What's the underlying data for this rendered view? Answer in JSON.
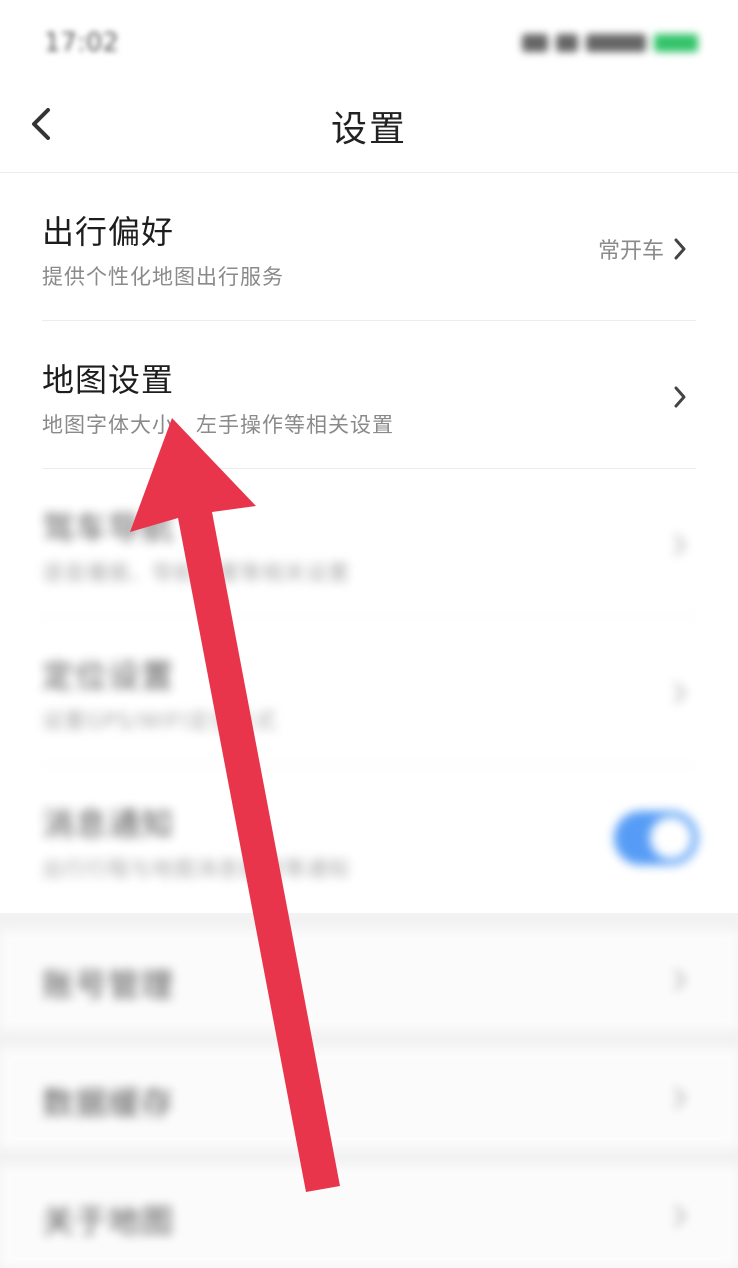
{
  "status_bar": {
    "time": "17:02"
  },
  "nav": {
    "title": "设置"
  },
  "settings": [
    {
      "title": "出行偏好",
      "subtitle": "提供个性化地图出行服务",
      "value": "常开车"
    },
    {
      "title": "地图设置",
      "subtitle": "地图字体大小、左手操作等相关设置"
    },
    {
      "title": "驾车导航",
      "subtitle": "语音播报、导航设置等相关设置"
    },
    {
      "title": "定位设置",
      "subtitle": "设置GPS/WIFI定位方式"
    },
    {
      "title": "消息通知",
      "subtitle": "出行行程与地图消息推送等通知"
    }
  ],
  "bottom_items": [
    {
      "title": "账号管理"
    },
    {
      "title": "数据缓存"
    },
    {
      "title": "关于地图"
    }
  ],
  "colors": {
    "accent_toggle": "#1e7cf3",
    "annotation_arrow": "#e8354b"
  }
}
